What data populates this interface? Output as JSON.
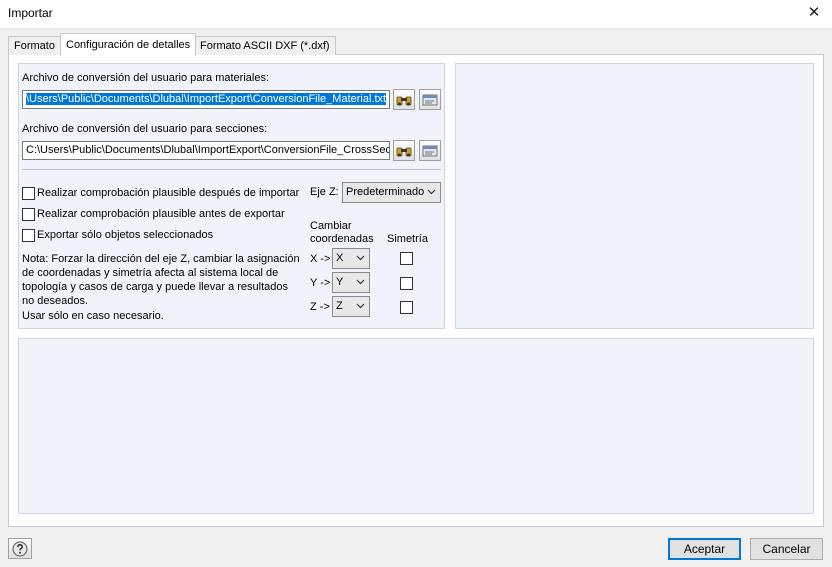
{
  "window": {
    "title": "Importar",
    "close_glyph": "✕"
  },
  "tabs": [
    {
      "label": "Formato",
      "active": false
    },
    {
      "label": "Configuración de detalles",
      "active": true
    },
    {
      "label": "Formato ASCII DXF (*.dxf)",
      "active": false
    }
  ],
  "materials": {
    "label": "Archivo de conversión del usuario para materiales:",
    "value": "\\Users\\Public\\Documents\\Dlubal\\ImportExport\\ConversionFile_Material.txt",
    "selected": true
  },
  "sections": {
    "label": "Archivo de conversión del usuario para secciones:",
    "value": "C:\\Users\\Public\\Documents\\Dlubal\\ImportExport\\ConversionFile_CrossSect"
  },
  "icons": {
    "browse": "binoculars-icon",
    "edit": "edit-file-icon",
    "help": "help-icon"
  },
  "options": [
    {
      "label": "Realizar comprobación plausible después de importar",
      "checked": false
    },
    {
      "label": "Realizar comprobación plausible antes de exportar",
      "checked": false
    },
    {
      "label": "Exportar sólo objetos seleccionados",
      "checked": false
    }
  ],
  "z_axis": {
    "label": "Eje Z:",
    "value": "Predeterminado"
  },
  "coords": {
    "header_change_line1": "Cambiar",
    "header_change_line2": "coordenadas",
    "header_sym": "Simetría",
    "rows": [
      {
        "label": "X ->",
        "value": "X",
        "sym": false
      },
      {
        "label": "Y ->",
        "value": "Y",
        "sym": false
      },
      {
        "label": "Z ->",
        "value": "Z",
        "sym": false
      }
    ]
  },
  "note": {
    "lines": [
      "Nota: Forzar la dirección del eje Z, cambiar la asignación",
      "de coordenadas y simetría afecta al sistema local de",
      "topología y casos de carga y puede llevar a resultados",
      "no deseados."
    ],
    "usage": "Usar sólo en caso necesario."
  },
  "buttons": {
    "accept": "Aceptar",
    "cancel": "Cancelar"
  }
}
